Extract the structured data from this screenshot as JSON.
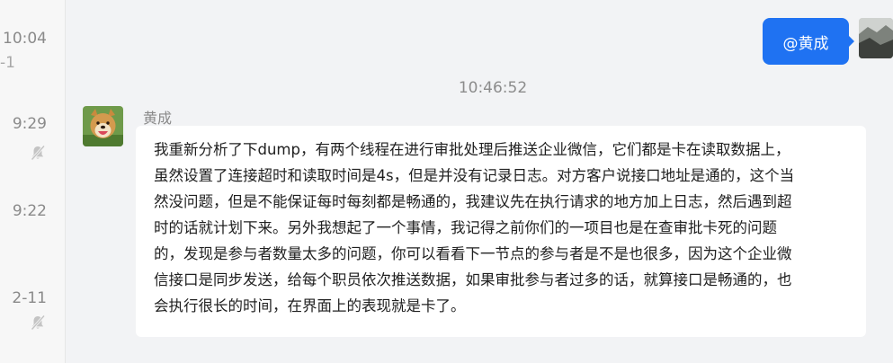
{
  "session_list": {
    "entries": [
      {
        "time": "10:04",
        "sub": "-1"
      },
      {
        "time": "9:29",
        "sub": ""
      },
      {
        "time": "9:22",
        "sub": ""
      },
      {
        "time": "2-11",
        "sub": ""
      }
    ]
  },
  "chat": {
    "sent_message": "@黄成",
    "timestamp": "10:46:52",
    "peer_name": "黄成",
    "message_lines": [
      "我重新分析了下dump，有两个线程在进行审批处理后推送企业微信，它们都是卡在读取数据上，",
      "虽然设置了连接超时和读取时间是4s，但是并没有记录日志。对方客户说接口地址是通的，这个当",
      "然没问题，但是不能保证每时每刻都是畅通的，我建议先在执行请求的地方加上日志，然后遇到超",
      "时的话就计划下来。另外我想起了一个事情，我记得之前你们的一项目也是在查审批卡死的问题",
      "的，发现是参与者数量太多的问题，你可以看看下一节点的参与者是不是也很多，因为这个企业微",
      "信接口是同步发送，给每个职员依次推送数据，如果审批参与者过多的话，就算接口是畅通的，也",
      "会执行很长的时间，在界面上的表现就是卡了。"
    ]
  },
  "icons": {
    "mute": "bell-muted-icon"
  },
  "colors": {
    "accent_blue": "#1f72f2",
    "chat_bg": "#f2f3f5",
    "bubble_bg": "#ffffff"
  }
}
